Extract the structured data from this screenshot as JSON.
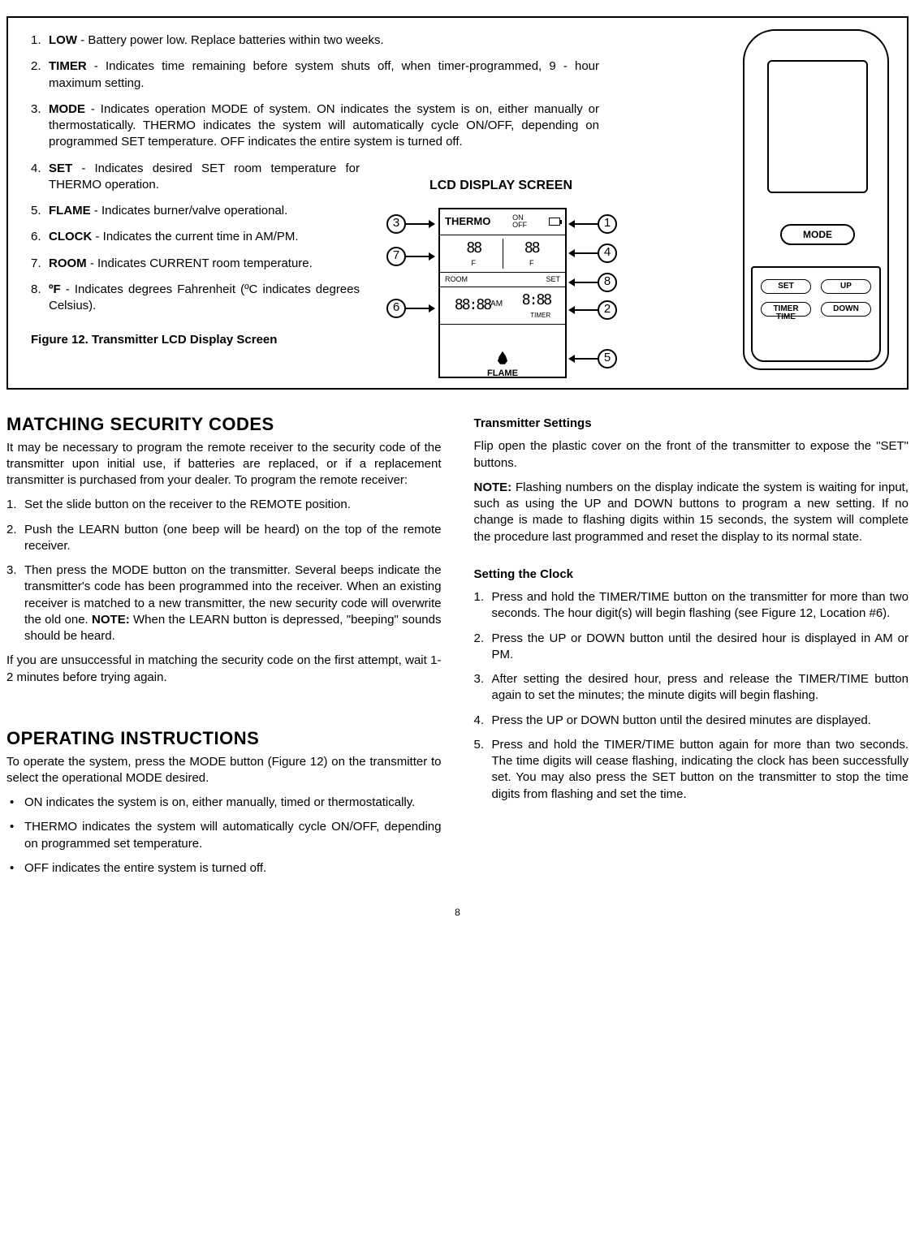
{
  "definitions": [
    {
      "term": "LOW",
      "text": " - Battery power low. Replace batteries within two weeks."
    },
    {
      "term": "TIMER",
      "text": " -  Indicates time remaining before system shuts off, when timer-programmed, 9 - hour maximum setting."
    },
    {
      "term": "MODE",
      "text": " - Indicates operation MODE of system. ON indicates the system is on, either manually or thermostatically. THERMO indicates the system will automatically cycle ON/OFF, depending on programmed SET temperature. OFF indicates the entire system is turned off."
    },
    {
      "term": "SET",
      "text": " - Indicates desired SET room temperature for THERMO operation."
    },
    {
      "term": "FLAME",
      "text": " - Indicates burner/valve operational."
    },
    {
      "term": "CLOCK",
      "text": " - Indicates the current time in AM/PM."
    },
    {
      "term": "ROOM",
      "text": " - Indicates CURRENT room temperature."
    },
    {
      "term": "ºF",
      "text": " - Indicates degrees Fahrenheit (ºC indicates degrees Celsius)."
    }
  ],
  "figure_caption": "Figure 12.   Transmitter LCD Display Screen",
  "lcd": {
    "heading": "LCD DISPLAY SCREEN",
    "thermo": "THERMO",
    "on": "ON",
    "off": "OFF",
    "room": "ROOM",
    "set": "SET",
    "f": "F",
    "am": "AM",
    "timer": "TIMER",
    "flame": "FLAME"
  },
  "callouts": {
    "c1": "1",
    "c2": "2",
    "c3": "3",
    "c4": "4",
    "c5": "5",
    "c6": "6",
    "c7": "7",
    "c8": "8"
  },
  "remote": {
    "mode": "MODE",
    "set": "SET",
    "up": "UP",
    "timer": "TIMER",
    "down": "DOWN",
    "time": "TIME"
  },
  "sec1": {
    "title": "MATCHING SECURITY CODES",
    "intro": "It may be necessary to program the remote receiver to the security code of the transmitter upon initial use, if batteries are replaced, or if a replacement transmitter is purchased from your dealer. To program the remote receiver:",
    "steps": [
      "Set the slide button on the receiver to the REMOTE position.",
      "Push the LEARN button (one beep will be heard) on the top of the remote receiver.",
      "Then press the MODE button on the transmitter. Several beeps indicate the transmitter's code has been programmed into the receiver. When an existing receiver is matched to a new transmitter, the new security code will overwrite the old one. NOTE: When the LEARN button is depressed, \"beeping\" sounds should be heard."
    ],
    "outro": "If you are unsuccessful in matching the security code on the first attempt, wait 1-2 minutes before trying again."
  },
  "sec2": {
    "title": "OPERATING INSTRUCTIONS",
    "intro": "To operate the system, press the MODE button (Figure 12) on the transmitter to select the operational MODE desired.",
    "bul": [
      "ON indicates the system is on, either manually, timed or thermostatically.",
      "THERMO indicates the system will automatically cycle ON/OFF, depending on programmed set temperature.",
      "OFF indicates the entire system is turned off."
    ]
  },
  "tx": {
    "h": "Transmitter Settings",
    "p1": "Flip open the plastic cover on the front of the transmitter to expose the \"SET\" buttons.",
    "note_label": "NOTE:",
    "note": " Flashing numbers on the display indicate the system is waiting for input, such as using the UP and DOWN buttons to program a new setting. If no change is made to flashing digits within 15 seconds, the system will complete the procedure last programmed and reset the display to its normal state."
  },
  "clock": {
    "h": "Setting the Clock",
    "steps": [
      "Press and hold the TIMER/TIME button on the transmitter for more than two seconds. The hour digit(s) will begin flashing (see Figure 12, Location #6).",
      "Press the UP or DOWN button until the desired hour is displayed in AM or PM.",
      "After setting the desired hour, press and release the TIMER/TIME button again to set the minutes; the minute digits will begin flashing.",
      "Press the UP or DOWN button until the desired minutes are displayed.",
      "Press and hold the TIMER/TIME button again for more than two seconds. The time digits will cease flashing, indicating the clock has been successfully set. You may also press the SET button on the transmitter to stop the time digits from flashing and set the time."
    ]
  },
  "page": "8"
}
